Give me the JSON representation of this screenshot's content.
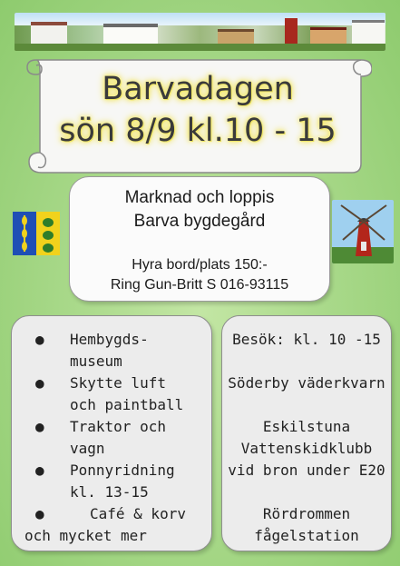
{
  "title": {
    "line1": "Barvadagen",
    "line2": "sön 8/9 kl.10 - 15"
  },
  "info": {
    "line1": "Marknad och loppis",
    "line2": "Barva bygdegård",
    "line3": "Hyra bord/plats 150:-",
    "line4": "Ring Gun-Britt S 016-93115"
  },
  "activities": {
    "items": [
      {
        "line1": "Hembygds-",
        "line2": "museum"
      },
      {
        "line1": "Skytte luft",
        "line2": "och paintball"
      },
      {
        "line1": "Traktor och",
        "line2": "vagn"
      },
      {
        "line1": "Ponnyridning",
        "line2": "kl. 13-15"
      },
      {
        "line1": "Café & korv",
        "line2": "och mycket mer"
      }
    ],
    "bullet": "●"
  },
  "visits": {
    "heading": "Besök: kl. 10 -15",
    "line1": "Söderby väderkvarn",
    "line2": "Eskilstuna",
    "line3": "Vattenskidklubb",
    "line4": "vid bron under E20",
    "line5": "Rördrommen",
    "line6": "fågelstation"
  },
  "colors": {
    "background": "#a9d98a",
    "title_glow": "#f3e65a",
    "box_fill": "#ececec",
    "crest_blue": "#1f4fb5",
    "crest_yellow": "#f1d21c",
    "mill_red": "#b3261b"
  }
}
